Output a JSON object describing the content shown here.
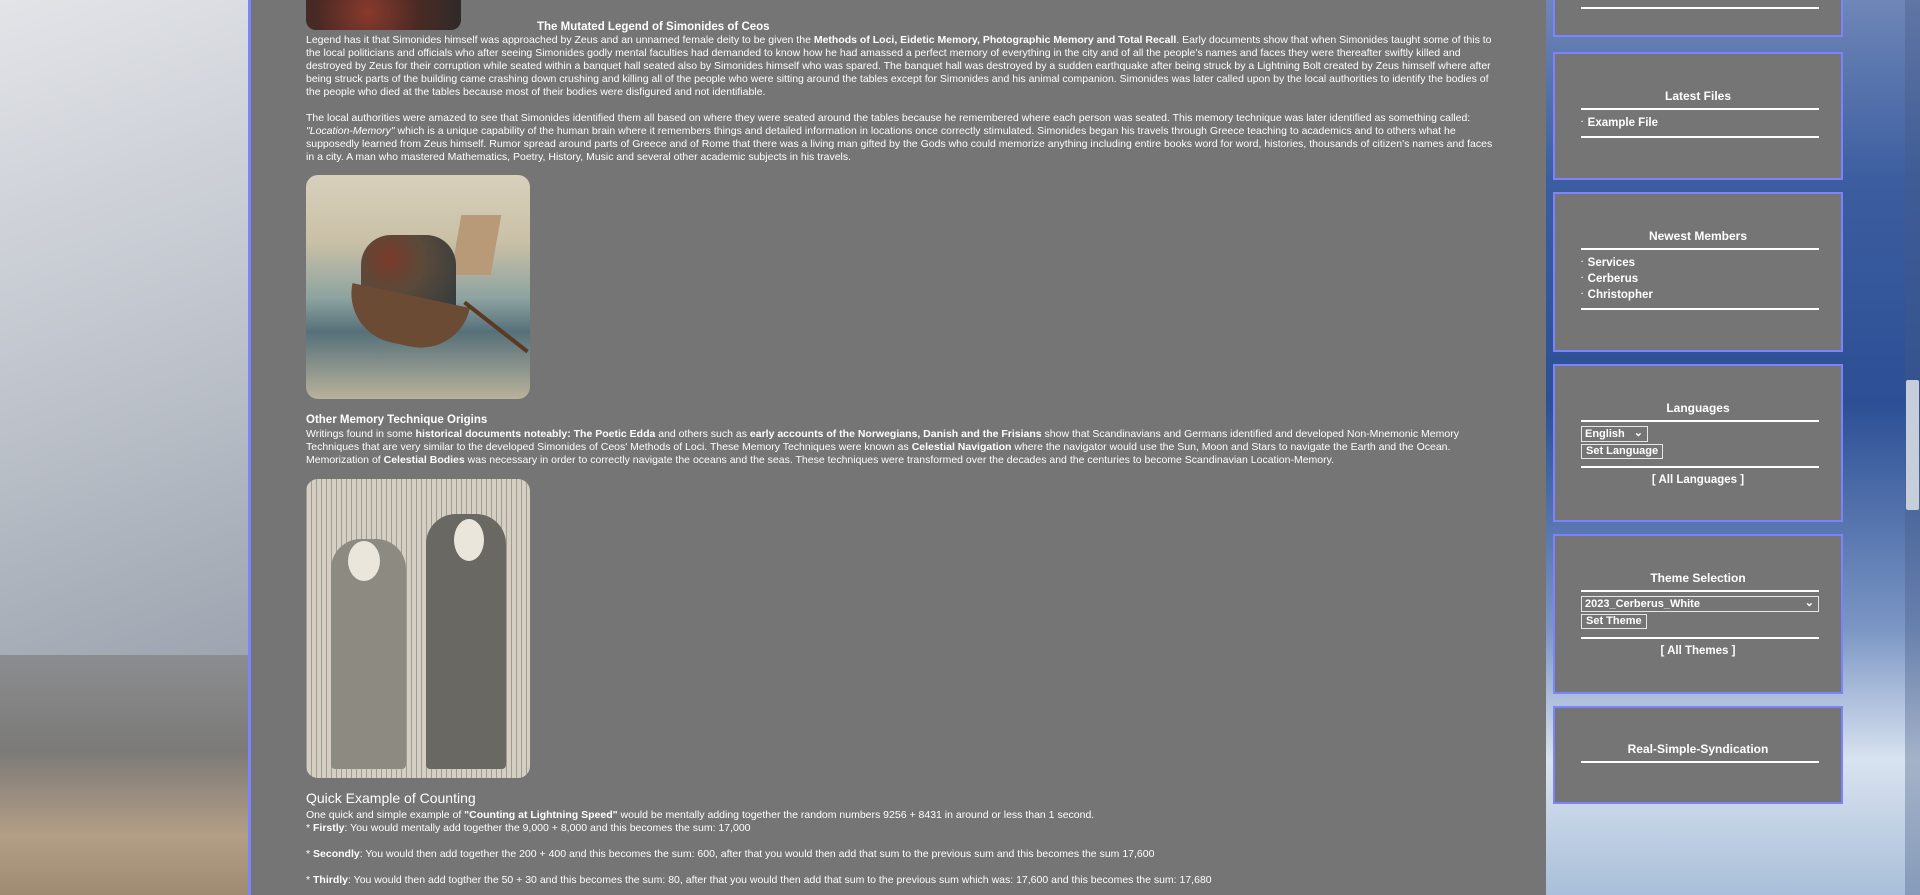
{
  "article": {
    "title_1": "The Mutated Legend of Simonides of Ceos",
    "p1_a": "Legend has it that Simonides himself was approached by Zeus and an unnamed female deity to be given the ",
    "p1_b": "Methods of Loci, Eidetic Memory, Photographic Memory and Total Recall",
    "p1_c": ". Early documents show that when Simonides taught some of this to the local politicians and officials who after seeing Simonides godly mental faculties had demanded to know how he had amassed a perfect memory of everything in the city and of all the people's names and faces they were thereafter swiftly killed and destroyed by Zeus for their corruption while seated within a banquet hall seated also by Simonides himself who was spared. The banquet hall was destroyed by a sudden earthquake after being struck by a Lightning Bolt created by Zeus himself where after being struck parts of the building came crashing down crushing and killing all of the people who were sitting around the tables except for Simonides and his animal companion. Simonides was later called upon by the local authorities to identify the bodies of the people who died at the tables because most of their bodies were disfigured and not identifiable.",
    "p2_a": "The local authorities were amazed to see that Simonides identified them all based on where they were seated around the tables because he remembered where each person was seated. This memory technique was later identified as something called: ",
    "p2_b": "\"Location-Memory\"",
    "p2_c": " which is a unique capability of the human brain where it remembers things and detailed information in locations once correctly stimulated. Simonides began his travels through Greece teaching to academics and to others what he supposedly learned from Zeus himself. Rumor spread around parts of Greece and of Rome that there was a living man gifted by the Gods who could memorize anything including entire books word for word, histories, thousands of citizen's names and faces in a city. A man who mastered Mathematics, Poetry, History, Music and several other academic subjects in his travels.",
    "title_2": "Other Memory Technique Origins",
    "p3_a": "Writings found in some ",
    "p3_b": "historical documents noteably: The Poetic Edda",
    "p3_c": " and others such as ",
    "p3_d": "early accounts of the Norwegians, Danish and the Frisians",
    "p3_e": " show that Scandinavians and Germans identified and developed Non-Mnemonic Memory Techniques that are very similar to the developed Simonides of Ceos' Methods of Loci. These Memory Techniques were known as ",
    "p3_f": "Celestial Navigation",
    "p3_g": " where the navigator would use the Sun, Moon and Stars to navigate the Earth and the Ocean. Memorization of ",
    "p3_h": "Celestial Bodies",
    "p3_i": " was necessary in order to correctly navigate the oceans and the seas. These techniques were transformed over the decades and the centuries to become Scandinavian Location-Memory.",
    "title_3": "Quick Example of Counting",
    "p4_a": "One quick and simple example of ",
    "p4_b": "\"Counting at Lightning Speed\"",
    "p4_c": " would be mentally adding together the random numbers 9256 + 8431 in around or less than 1 second.",
    "s1_a": "* ",
    "s1_b": "Firstly",
    "s1_c": ": You would mentally add together the 9,000 + 8,000 and this becomes the sum: 17,000",
    "s2_b": "Secondly",
    "s2_c": ": You would then add together the 200 + 400 and this becomes the sum: 600, after that you would then add that sum to the previous sum and this becomes the sum 17,600",
    "s3_b": "Thirdly",
    "s3_c": ": You would then add togther the 50 + 30 and this becomes the sum: 80, after that you would then add that sum to the previous sum which was: 17,600 and this becomes the sum: 17,680"
  },
  "sidebar": {
    "latest_files": {
      "title": "Latest Files",
      "items": [
        "Example File"
      ]
    },
    "newest_members": {
      "title": "Newest Members",
      "items": [
        "Services",
        "Cerberus",
        "Christopher"
      ]
    },
    "languages": {
      "title": "Languages",
      "selected": "English",
      "button": "Set Language",
      "link": "[ All Languages ]"
    },
    "theme": {
      "title": "Theme Selection",
      "selected": "2023_Cerberus_White",
      "button": "Set Theme",
      "link": "[ All Themes ]"
    },
    "rss": {
      "title": "Real-Simple-Syndication"
    }
  },
  "icons": {
    "bullet": "·",
    "dropdown": "⌄"
  }
}
